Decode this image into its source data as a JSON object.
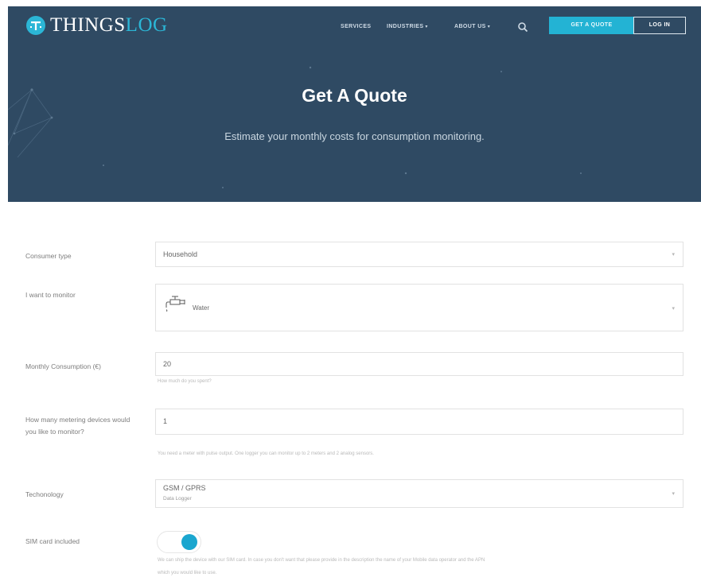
{
  "brand": {
    "name_part1": "THINGS",
    "name_part2": "LOG",
    "accent": "#2bb6d6"
  },
  "nav": {
    "items": [
      {
        "label": "SERVICES",
        "caret": ""
      },
      {
        "label": "INDUSTRIES",
        "caret": "▾"
      },
      {
        "label": "ABOUT US",
        "caret": "▾"
      }
    ],
    "search_icon": "search-icon",
    "quote_button": "GET A QUOTE",
    "login_button": "LOG IN"
  },
  "hero": {
    "title": "Get A Quote",
    "subtitle": "Estimate your monthly costs for consumption monitoring.",
    "background": "#2f4a63"
  },
  "form": {
    "consumer_type": {
      "label": "Consumer type",
      "value": "Household"
    },
    "monitor": {
      "label": "I want to monitor",
      "value": "Water",
      "icon": "faucet-icon"
    },
    "consumption": {
      "label": "Monthly Consumption (€)",
      "value": "20",
      "help": "How much do you spent?"
    },
    "devices": {
      "label": "How many metering devices would you like to monitor?",
      "value": "1",
      "help": "You need a meter with pulse output. One logger you can monitor up to 2 meters and 2 analog sensors."
    },
    "technology": {
      "label": "Techonology",
      "value": "GSM / GPRS",
      "subvalue": "Data Logger"
    },
    "sim": {
      "label": "SIM card included",
      "enabled": true,
      "help_line1": "We can ship the device with our SIM card. In case you don't want that please provide in the description the name of your Mobile data operator and the APN",
      "help_line2": "which you would like to use."
    },
    "toggle_color": "#1aa6cf"
  }
}
